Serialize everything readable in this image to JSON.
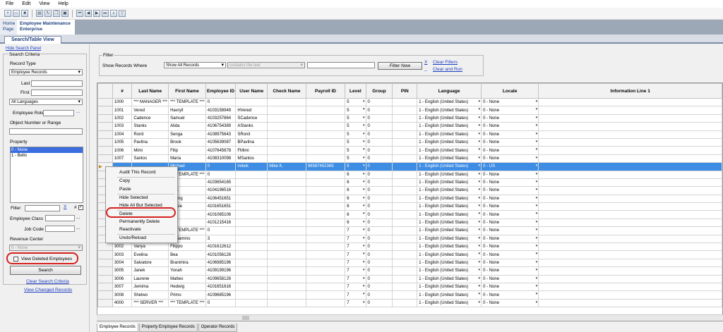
{
  "menu": [
    "File",
    "Edit",
    "View",
    "Help"
  ],
  "toolbar_icons": [
    "new-icon",
    "open-icon",
    "save-icon",
    "print-icon",
    "refresh-icon",
    "copy-icon",
    "paste-icon",
    "first-record-icon",
    "prev-record-icon",
    "next-record-icon",
    "last-record-icon",
    "find-icon",
    "filter-icon"
  ],
  "header_tabs": {
    "home_line1": "Home",
    "home_line2": "Page",
    "emp_line1": "Employee Maintenance",
    "emp_line2": "Enterprise"
  },
  "view_tab": "Search/Table View",
  "left": {
    "hide_panel": "Hide Search Panel",
    "criteria_title": "Search Criteria",
    "record_type_label": "Record Type",
    "record_type_value": "Employee Records",
    "last_label": "Last",
    "first_label": "First",
    "languages_value": "All Languages",
    "employee_role_label": "Employee Role",
    "object_number_label": "Object Number or Range",
    "property_label": "Property",
    "property_items": [
      "0 - None",
      "1 - Bello"
    ],
    "filter_label": "Filter",
    "filter_x": "X",
    "filter_hash": "#",
    "employee_class_label": "Employee Class",
    "job_code_label": "Job Code",
    "revenue_center_label": "Revenue Center",
    "revenue_center_value": "0 - None",
    "view_deleted_label": "View Deleted Employees",
    "search_button": "Search",
    "clear_link": "Clear Search Criteria",
    "view_changed_link": "View Changed Records"
  },
  "filter": {
    "title": "Filter",
    "show_label": "Show Records Where",
    "field_value": "Show All Records",
    "op_value": "contains the text",
    "text_value": "",
    "button": "Filter Now",
    "x": "X",
    "clear_filters": "Clear Filters",
    "clear_and_run": "Clear and Run"
  },
  "grid": {
    "headers": [
      "#",
      "Last Name",
      "First Name",
      "Employee ID",
      "User Name",
      "Check Name",
      "Payroll ID",
      "Level",
      "Group",
      "PIN",
      "Language",
      "Locale",
      "Information Line 1"
    ],
    "rows": [
      [
        "1000",
        "*** MANAGER ***",
        "*** TEMPLATE ***",
        "0",
        "",
        "",
        "",
        "5",
        "0",
        "",
        "1 - English (United States)",
        "0 - None",
        ""
      ],
      [
        "1001",
        "Vered",
        "Havryil",
        "4103158949",
        "HVered",
        "",
        "",
        "5",
        "0",
        "",
        "1 - English (United States)",
        "0 - None",
        ""
      ],
      [
        "1002",
        "Cadence",
        "Samuel",
        "4103257864",
        "SCadence",
        "",
        "",
        "5",
        "0",
        "",
        "1 - English (United States)",
        "0 - None",
        ""
      ],
      [
        "1003",
        "Stanks",
        "Alida",
        "4106754389",
        "AStanks",
        "",
        "",
        "5",
        "0",
        "",
        "1 - English (United States)",
        "0 - None",
        ""
      ],
      [
        "1004",
        "Ronit",
        "Senga",
        "4108975643",
        "SRonit",
        "",
        "",
        "5",
        "0",
        "",
        "1 - English (United States)",
        "0 - None",
        ""
      ],
      [
        "1005",
        "Pavlina",
        "Brook",
        "4105639087",
        "BPavlina",
        "",
        "",
        "5",
        "0",
        "",
        "1 - English (United States)",
        "0 - None",
        ""
      ],
      [
        "1006",
        "Mimi",
        "Filip",
        "4107645678",
        "FMimi",
        "",
        "",
        "5",
        "0",
        "",
        "1 - English (United States)",
        "0 - None",
        ""
      ],
      [
        "1007",
        "Santos",
        "Maria",
        "4108310098",
        "MSantos",
        "",
        "",
        "5",
        "0",
        "",
        "1 - English (United States)",
        "0 - None",
        ""
      ],
      [
        "",
        "",
        "Michael",
        "0",
        "mikek",
        "Mike K.",
        "96587452365",
        "5",
        "0",
        "",
        "1 - English (United States)",
        "0 - US",
        ""
      ],
      [
        "",
        "",
        "*** TEMPLATE ***",
        "0",
        "",
        "",
        "",
        "6",
        "0",
        "",
        "1 - English (United States)",
        "0 - None",
        ""
      ],
      [
        "",
        "",
        "Zita",
        "4103654165",
        "",
        "",
        "",
        "6",
        "0",
        "",
        "1 - English (United States)",
        "0 - None",
        ""
      ],
      [
        "",
        "",
        "Lark",
        "4104196516",
        "",
        "",
        "",
        "6",
        "0",
        "",
        "1 - English (United States)",
        "0 - None",
        ""
      ],
      [
        "",
        "",
        "Cheng",
        "4106451651",
        "",
        "",
        "",
        "6",
        "0",
        "",
        "1 - English (United States)",
        "0 - None",
        ""
      ],
      [
        "",
        "",
        "Jessie",
        "4101651651",
        "",
        "",
        "",
        "6",
        "0",
        "",
        "1 - English (United States)",
        "0 - None",
        ""
      ],
      [
        "",
        "",
        "Fen",
        "4101065106",
        "",
        "",
        "",
        "6",
        "0",
        "",
        "1 - English (United States)",
        "0 - None",
        ""
      ],
      [
        "",
        "",
        "Jilly",
        "4101215416",
        "",
        "",
        "",
        "6",
        "0",
        "",
        "1 - English (United States)",
        "0 - None",
        ""
      ],
      [
        "",
        "",
        "*** TEMPLATE ***",
        "0",
        "",
        "",
        "",
        "7",
        "0",
        "",
        "1 - English (United States)",
        "0 - None",
        ""
      ],
      [
        "",
        "",
        "Beniamino",
        "3",
        "",
        "",
        "",
        "7",
        "0",
        "",
        "1 - English (United States)",
        "0 - None",
        ""
      ],
      [
        "3002",
        "Vanya",
        "Filippo",
        "4101612612",
        "",
        "",
        "",
        "7",
        "0",
        "",
        "1 - English (United States)",
        "0 - None",
        ""
      ],
      [
        "3003",
        "Evelina",
        "Bea",
        "4101056126",
        "",
        "",
        "",
        "7",
        "0",
        "",
        "1 - English (United States)",
        "0 - None",
        ""
      ],
      [
        "3004",
        "Salvatore",
        "Branimira",
        "4106985196",
        "",
        "",
        "",
        "7",
        "0",
        "",
        "1 - English (United States)",
        "0 - None",
        ""
      ],
      [
        "3005",
        "Janek",
        "Yonah",
        "4109199196",
        "",
        "",
        "",
        "7",
        "0",
        "",
        "1 - English (United States)",
        "0 - None",
        ""
      ],
      [
        "3006",
        "Laurene",
        "Matteo",
        "4109658126",
        "",
        "",
        "",
        "7",
        "0",
        "",
        "1 - English (United States)",
        "0 - None",
        ""
      ],
      [
        "3007",
        "Jemima",
        "Hedwig",
        "4101651616",
        "",
        "",
        "",
        "7",
        "0",
        "",
        "1 - English (United States)",
        "0 - None",
        ""
      ],
      [
        "3008",
        "Shelwo",
        "Primo",
        "4109685196",
        "",
        "",
        "",
        "7",
        "0",
        "",
        "1 - English (United States)",
        "0 - None",
        ""
      ],
      [
        "4000",
        "*** SERVER ***",
        "*** TEMPLATE ***",
        "0",
        "",
        "",
        "",
        "7",
        "0",
        "",
        "1 - English (United States)",
        "0 - None",
        ""
      ]
    ]
  },
  "context_menu": [
    "Audit This Record",
    "Copy",
    "Paste",
    "Hide Selected",
    "Hide All But Selected",
    "Delete",
    "Permanently Delete",
    "Reactivate",
    "Undo/Reload"
  ],
  "bottom_tabs": [
    "Employee Records",
    "Property Employee Records",
    "Operator Records"
  ],
  "colors": {
    "selection": "#3d8de5",
    "annotation": "#d52020",
    "link": "#1f3fbf"
  }
}
